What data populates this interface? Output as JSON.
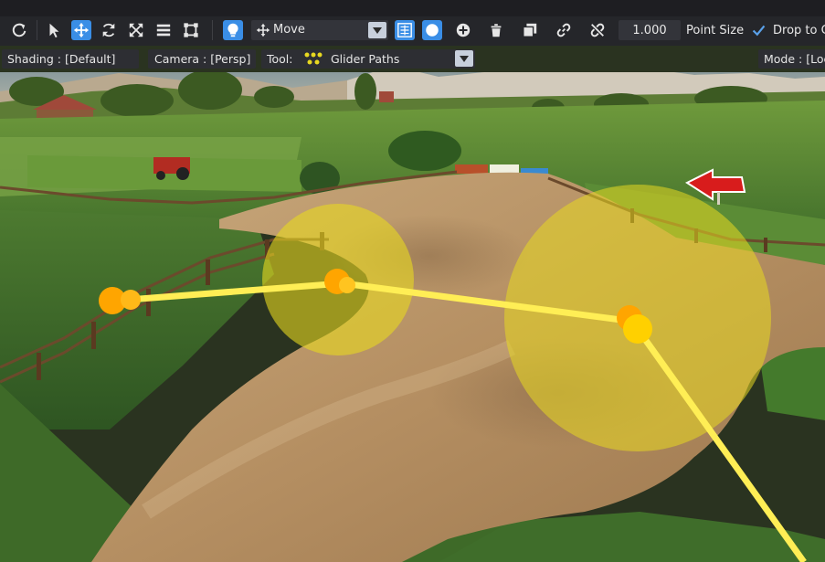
{
  "toolbar": {
    "move_dropdown_label": "Move",
    "point_size_value": "1.000",
    "point_size_label": "Point Size",
    "drop_to_label": "Drop to C"
  },
  "status": {
    "shading": "Shading : [Default]",
    "camera": "Camera : [Persp]",
    "tool_label": "Tool:",
    "tool_value": "Glider Paths",
    "mode": "Mode : [Loc"
  },
  "viewport": {
    "signs": [
      "",
      "",
      ""
    ]
  },
  "colors": {
    "accent": "#3a8ee6",
    "path_line": "#ffee55",
    "path_node": "#ffa500",
    "radius_fill": "#e8d820",
    "arrow": "#e02020"
  }
}
